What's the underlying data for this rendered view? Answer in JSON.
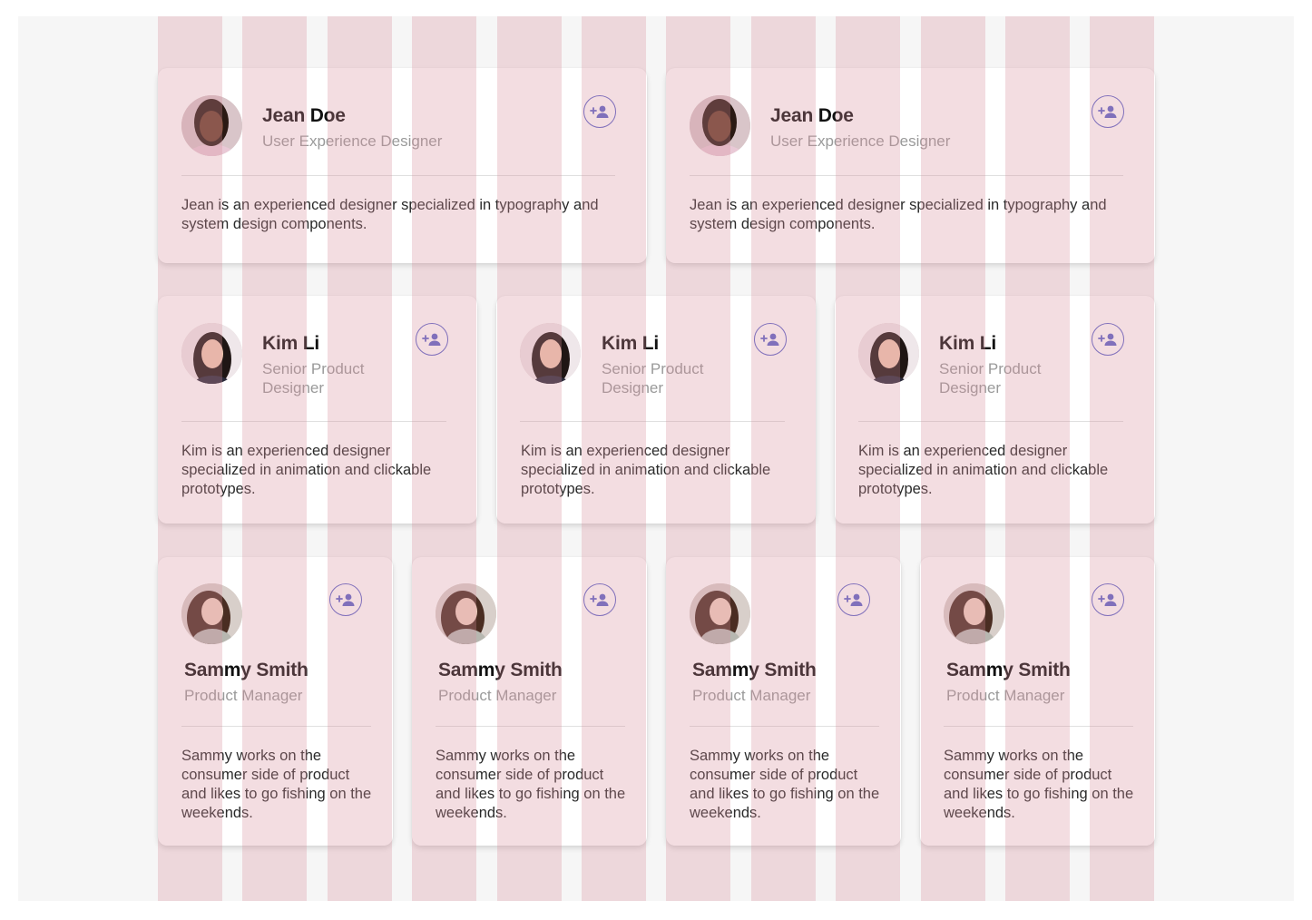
{
  "cards": {
    "jean": {
      "name": "Jean Doe",
      "role": "User Experience Designer",
      "bio": "Jean is an experienced designer specialized in typography and system design components."
    },
    "kim": {
      "name": "Kim Li",
      "role": "Senior Product Designer",
      "bio": "Kim is an experienced designer specialized in animation and clickable prototypes."
    },
    "sammy": {
      "name": "Sammy Smith",
      "role": "Product Manager",
      "bio": "Sammy works on the consumer side of product and likes to go fishing on the weekends."
    }
  },
  "icons": {
    "add_user": "person-add-icon",
    "avatar": "avatar-photo"
  },
  "colors": {
    "background": "#f6f6f6",
    "card": "#ffffff",
    "grid_overlay": "#d68e9b",
    "accent": "#5b63c9",
    "name_text": "#111111",
    "role_text": "#9a9a9a",
    "bio_text": "#2a2a2a"
  }
}
